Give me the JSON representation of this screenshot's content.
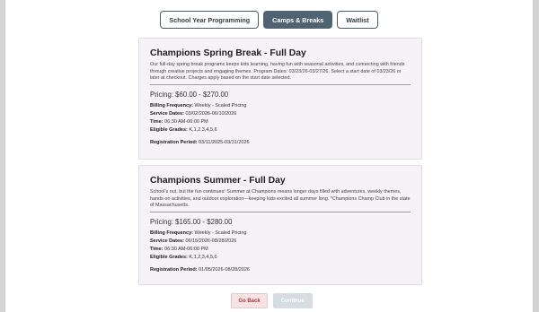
{
  "tabs": [
    {
      "label": "School Year Programming",
      "active": false
    },
    {
      "label": "Camps & Breaks",
      "active": true
    },
    {
      "label": "Waitlist",
      "active": false
    }
  ],
  "programs": [
    {
      "title": "Champions Spring Break - Full Day",
      "description": "Our full-day spring break programs keeps kids learning, having fun with seasonal activities, and connecting with friends through creative projects and engaging themes. Program Dates: 03/23/26-03/27/26. Select a start date of 03/23/26 or later at checkout. Charges apply based on the start date selected.",
      "pricing": "Pricing: $60.00 - $270.00",
      "billing_label": "Billing Frequency:",
      "billing_value": "Weekly - Scaled Pricing",
      "service_label": "Service Dates:",
      "service_value": "03/02/2026-06/10/2026",
      "time_label": "Time:",
      "time_value": "06:30 AM-06:00 PM",
      "grades_label": "Eligible Grades:",
      "grades_value": "K,1,2,3,4,5,6",
      "registration_label": "Registration Period:",
      "registration_value": "03/11/2025-03/31/2026"
    },
    {
      "title": "Champions Summer - Full Day",
      "description": "School's out, but the fun continues! Summer at Champions means longer days filled with adventures, weekly themes, hands-on activities, and outdoor exploration—keeping kids excited all summer long. *Champions Champ Club in the state of Massachusetts.",
      "pricing": "Pricing: $165.00 - $280.00",
      "billing_label": "Billing Frequency:",
      "billing_value": "Weekly - Scaled Pricing",
      "service_label": "Service Dates:",
      "service_value": "06/15/2026-08/28/2026",
      "time_label": "Time:",
      "time_value": "06:30 AM-06:00 PM",
      "grades_label": "Eligible Grades:",
      "grades_value": "K,1,2,3,4,5,6",
      "registration_label": "Registration Period:",
      "registration_value": "01/05/2026-08/28/2026"
    }
  ],
  "actions": {
    "back_label": "Go Back",
    "continue_label": "Continue",
    "continue_enabled": false
  },
  "colors": {
    "tab_active_bg": "#4f6470",
    "card_bg": "#f7f2f8",
    "back_text": "#b2333d",
    "continue_disabled_bg": "#d6dde1"
  }
}
